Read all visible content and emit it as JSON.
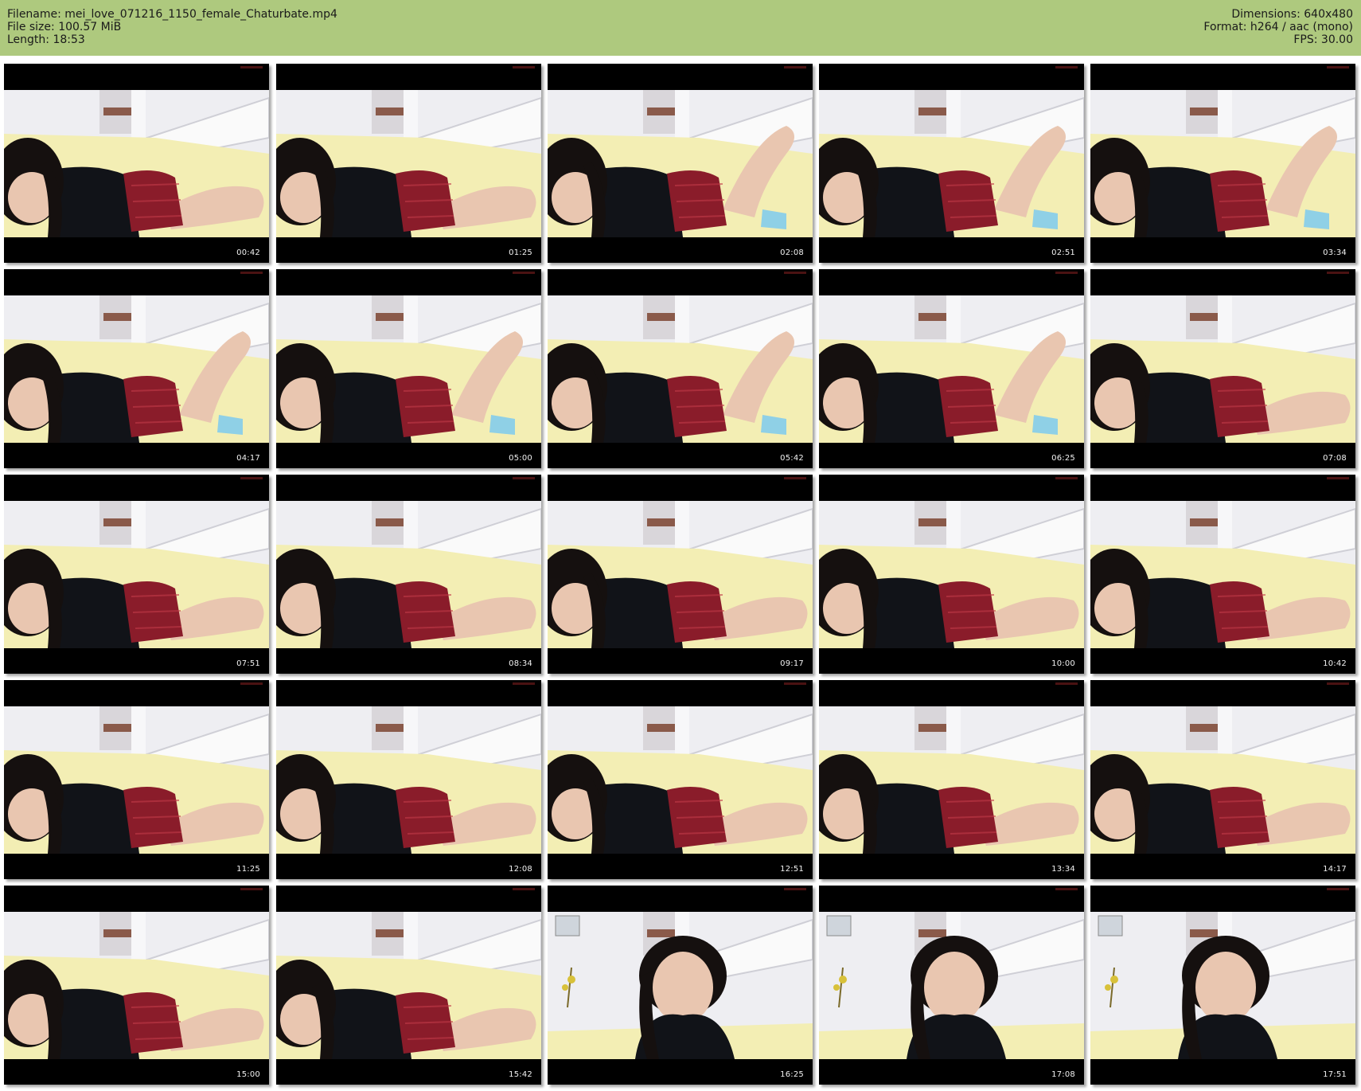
{
  "header": {
    "filename_label": "Filename: mei_love_071216_1150_female_Chaturbate.mp4",
    "filesize_label": "File size: 100.57 MiB",
    "length_label": "Length: 18:53",
    "dimensions_label": "Dimensions: 640x480",
    "format_label": "Format: h264 / aac (mono)",
    "fps_label": "FPS: 30.00"
  },
  "colors": {
    "header_bg": "#aec97e",
    "frame_bg": "#000000",
    "bedsheet": "#f3eeb4",
    "wall": "#eeeef2",
    "skirt": "#8a1c2a",
    "top": "#111318",
    "hair": "#15100f",
    "skin": "#e9c6b0",
    "sock": "#8fd0e6"
  },
  "thumbnails": [
    {
      "timestamp": "00:42",
      "scene": "lying"
    },
    {
      "timestamp": "01:25",
      "scene": "lying"
    },
    {
      "timestamp": "02:08",
      "scene": "lying-leg"
    },
    {
      "timestamp": "02:51",
      "scene": "lying-leg"
    },
    {
      "timestamp": "03:34",
      "scene": "lying-leg"
    },
    {
      "timestamp": "04:17",
      "scene": "lying-leg"
    },
    {
      "timestamp": "05:00",
      "scene": "lying-leg"
    },
    {
      "timestamp": "05:42",
      "scene": "lying-leg"
    },
    {
      "timestamp": "06:25",
      "scene": "lying-leg"
    },
    {
      "timestamp": "07:08",
      "scene": "lying"
    },
    {
      "timestamp": "07:51",
      "scene": "lying"
    },
    {
      "timestamp": "08:34",
      "scene": "lying"
    },
    {
      "timestamp": "09:17",
      "scene": "lying"
    },
    {
      "timestamp": "10:00",
      "scene": "lying"
    },
    {
      "timestamp": "10:42",
      "scene": "lying"
    },
    {
      "timestamp": "11:25",
      "scene": "lying"
    },
    {
      "timestamp": "12:08",
      "scene": "lying"
    },
    {
      "timestamp": "12:51",
      "scene": "lying"
    },
    {
      "timestamp": "13:34",
      "scene": "lying"
    },
    {
      "timestamp": "14:17",
      "scene": "lying"
    },
    {
      "timestamp": "15:00",
      "scene": "lying"
    },
    {
      "timestamp": "15:42",
      "scene": "lying"
    },
    {
      "timestamp": "16:25",
      "scene": "sitting"
    },
    {
      "timestamp": "17:08",
      "scene": "sitting"
    },
    {
      "timestamp": "17:51",
      "scene": "sitting"
    }
  ]
}
